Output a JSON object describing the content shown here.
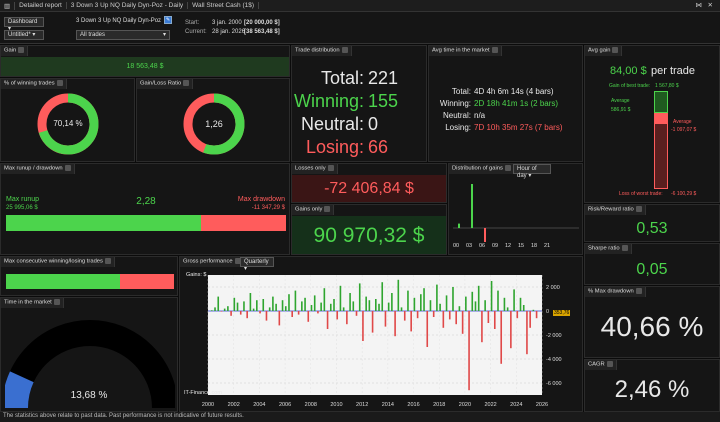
{
  "titlebar": {
    "items": [
      "Detailed report",
      "3 Down  3 Up NQ Daily Dyn-Poz - Daily",
      "Wall Street Cash (1$)"
    ]
  },
  "toolbar": {
    "dashboard_label": "Dashboard",
    "untitled_label": "Untitled*",
    "strategy_name": "3 Down  3 Up NQ Daily Dyn-Poz",
    "trades_select": "All trades",
    "start_label": "Start:",
    "start_value": "3 jan. 2000",
    "start_amount": "[20 000,00 $]",
    "current_label": "Current:",
    "current_value": "28 jan. 2026",
    "current_amount": "[38 563,48 $]"
  },
  "gain": {
    "title": "Gain",
    "value": "18 563,48 $"
  },
  "winning_trades": {
    "title": "% of winning trades",
    "value": "70,14 %",
    "fraction": 0.7014
  },
  "gain_loss": {
    "title": "Gain/Loss Ratio",
    "value": "1,26",
    "fraction": 0.557
  },
  "trade_distribution": {
    "title": "Trade distribution",
    "total_label": "Total:",
    "total": "221",
    "winning_label": "Winning:",
    "winning": "155",
    "neutral_label": "Neutral:",
    "neutral": "0",
    "losing_label": "Losing:",
    "losing": "66"
  },
  "avg_time": {
    "title": "Avg time in the market",
    "total_label": "Total:",
    "total": "4D 4h 6m 14s (4 bars)",
    "winning_label": "Winning:",
    "winning": "2D 18h 41m 1s (2 bars)",
    "neutral_label": "Neutral:",
    "neutral": "n/a",
    "losing_label": "Losing:",
    "losing": "7D 10h 35m 27s (7 bars)"
  },
  "avg_gain": {
    "title": "Avg gain",
    "value": "84,00 $",
    "unit": "per trade",
    "best_label": "Gain of best trade:",
    "best_value": "1 567,80 $",
    "avg_label_1": "Average",
    "avg_value_1": "586,91 $",
    "avg_label_2": "Average",
    "avg_value_2": "-1 097,07 $",
    "worst_label": "Loss of worst trade:",
    "worst_value": "-6 100,29 $"
  },
  "max_runup": {
    "title": "Max runup / drawdown",
    "runup_label": "Max runup",
    "runup_value": "25 995,06 $",
    "ratio": "2,28",
    "drawdown_label": "Max drawdown",
    "drawdown_value": "-11 347,29 $",
    "runup_fraction": 0.696
  },
  "losses_only": {
    "title": "Losses only",
    "value": "-72 406,84 $"
  },
  "gains_only": {
    "title": "Gains only",
    "value": "90 970,32 $"
  },
  "distribution": {
    "title": "Distribution of gains",
    "select": "Hour of day",
    "ticks": [
      "00",
      "03",
      "06",
      "09",
      "12",
      "15",
      "18",
      "21"
    ]
  },
  "risk_reward": {
    "title": "Risk/Reward ratio",
    "value": "0,53"
  },
  "sharpe": {
    "title": "Sharpe ratio",
    "value": "0,05"
  },
  "max_consec": {
    "title": "Max consecutive winning/losing trades",
    "win_fraction": 0.68
  },
  "gross_performance": {
    "title": "Gross performance",
    "select": "Quarterly",
    "legend": "Gains: $",
    "watermark": "IT-Finance.com",
    "current_marker": "353,76",
    "y_ticks": [
      "2 000",
      "0",
      "-2 000",
      "-4 000",
      "-6 000"
    ],
    "x_ticks": [
      "2000",
      "2002",
      "2004",
      "2006",
      "2008",
      "2010",
      "2012",
      "2014",
      "2016",
      "2018",
      "2020",
      "2022",
      "2024",
      "2026"
    ]
  },
  "max_drawdown_pct": {
    "title": "% Max drawdown",
    "value": "40,66 %"
  },
  "time_in_market": {
    "title": "Time in the market",
    "value": "13,68 %",
    "fraction": 0.1368
  },
  "cagr": {
    "title": "CAGR",
    "value": "2,46 %"
  },
  "footer": {
    "text": "The statistics above relate to past data. Past performance is not indicative of future results."
  },
  "colors": {
    "green": "#4cd44c",
    "red": "#ff5c5c",
    "bg": "#151515"
  },
  "chart_data": [
    {
      "type": "bar",
      "title": "Gross performance",
      "legend": [
        "Gains: $"
      ],
      "x_range": [
        2000,
        2026
      ],
      "ylim": [
        -7000,
        3000
      ],
      "grid": true,
      "series": [
        {
          "name": "Gains: $",
          "values": [
            60,
            300,
            1200,
            -50,
            200,
            400,
            -400,
            1100,
            700,
            -300,
            800,
            -600,
            1500,
            200,
            900,
            -200,
            1000,
            -800,
            300,
            1200,
            600,
            -1200,
            900,
            400,
            1400,
            -500,
            1700,
            -300,
            800,
            1100,
            -900,
            500,
            1300,
            -200,
            700,
            1900,
            -1500,
            600,
            1000,
            -700,
            2100,
            300,
            -1100,
            1500,
            800,
            -400,
            2300,
            -2500,
            1200,
            900,
            -1800,
            1000,
            600,
            2400,
            -1300,
            700,
            1500,
            -2100,
            2600,
            300,
            -800,
            1700,
            -1700,
            1100,
            -600,
            1400,
            1900,
            -3000,
            900,
            -500,
            2200,
            600,
            -1400,
            1300,
            -700,
            2000,
            -1100,
            400,
            -1900,
            1200,
            -6600,
            1600,
            800,
            2100,
            -2600,
            900,
            -1000,
            2500,
            -1500,
            1700,
            -4400,
            1100,
            300,
            -3100,
            1800,
            -600,
            1100,
            500,
            -3600,
            -1400,
            100,
            -600
          ]
        }
      ]
    },
    {
      "type": "bar",
      "title": "Distribution of gains",
      "categories": [
        "00",
        "03",
        "06",
        "09",
        "12",
        "15",
        "18",
        "21"
      ],
      "series": [
        {
          "values": [
            2,
            20,
            -8,
            0,
            0,
            0,
            0,
            0
          ]
        }
      ]
    }
  ]
}
